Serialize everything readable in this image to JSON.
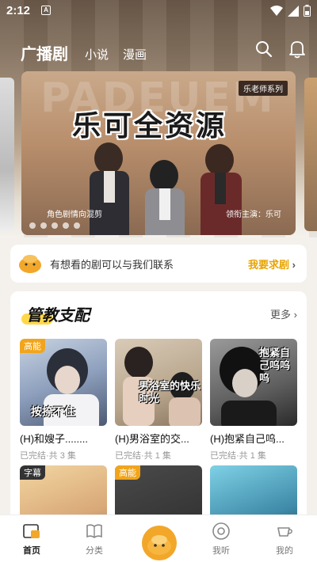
{
  "status_bar": {
    "time": "2:12",
    "notification_icon": "A"
  },
  "top_nav": {
    "tabs": [
      {
        "label": "广播剧",
        "active": true
      },
      {
        "label": "小说"
      },
      {
        "label": "漫画"
      }
    ]
  },
  "banner": {
    "background_text": "PADEUEM",
    "series_tag": "乐老师系列",
    "title": "乐可全资源",
    "caption_left": "角色剧情向混剪",
    "caption_right": "领衔主演：乐可",
    "dots": 5
  },
  "request": {
    "text": "有想看的剧可以与我们联系",
    "cta": "我要求剧"
  },
  "section": {
    "title": "管教支配",
    "more": "更多",
    "cards": [
      {
        "badge": "高能",
        "cover_text": "按捺不住",
        "name": "(H)和嫂子........",
        "meta": "已完结·共 3 集"
      },
      {
        "badge": "",
        "cover_text": "男浴室的快乐时光",
        "name": "(H)男浴室的交...",
        "meta": "已完结·共 1 集"
      },
      {
        "badge": "",
        "cover_text": "抱紧自己呜呜呜",
        "name": "(H)抱紧自己呜...",
        "meta": "已完结·共 1 集"
      },
      {
        "badge": "字幕"
      },
      {
        "badge": "高能"
      },
      {
        "badge": ""
      }
    ]
  },
  "bottom_nav": [
    {
      "label": "首页",
      "active": true
    },
    {
      "label": "分类"
    },
    {
      "label": ""
    },
    {
      "label": "我听"
    },
    {
      "label": "我的"
    }
  ],
  "colors": {
    "accent": "#f2a72a",
    "badge": "#f1a51c",
    "cta": "#e8a400"
  }
}
